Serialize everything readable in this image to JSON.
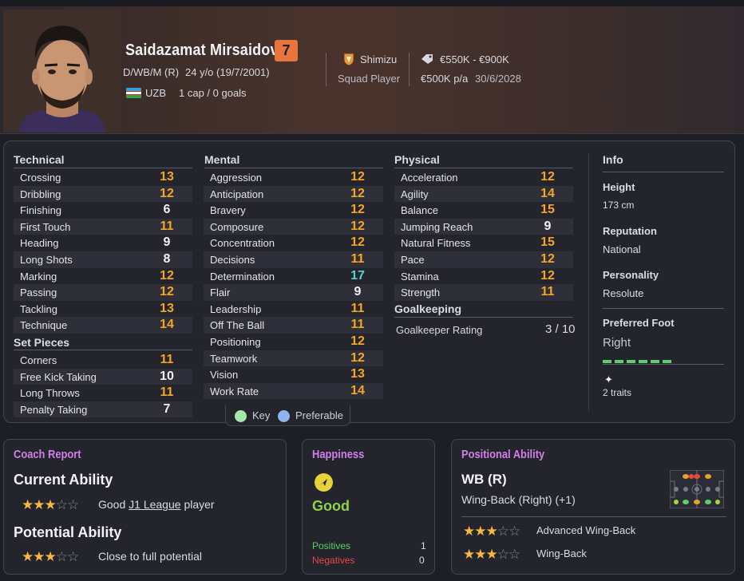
{
  "player": {
    "name": "Saidazamat Mirsaidov",
    "number": "7",
    "positions": "D/WB/M (R)",
    "age": "24 y/o (19/7/2001)",
    "nation": "UZB",
    "caps": "1 cap / 0 goals",
    "club": "Shimizu",
    "squad_status": "Squad Player",
    "value": "€550K - €900K",
    "wage": "€500K p/a",
    "contract_end": "30/6/2028"
  },
  "technical": {
    "title": "Technical",
    "rows": [
      {
        "label": "Crossing",
        "value": "13",
        "color": "orange"
      },
      {
        "label": "Dribbling",
        "value": "12",
        "color": "orange"
      },
      {
        "label": "Finishing",
        "value": "6",
        "color": "white"
      },
      {
        "label": "First Touch",
        "value": "11",
        "color": "orange"
      },
      {
        "label": "Heading",
        "value": "9",
        "color": "white"
      },
      {
        "label": "Long Shots",
        "value": "8",
        "color": "white"
      },
      {
        "label": "Marking",
        "value": "12",
        "color": "orange"
      },
      {
        "label": "Passing",
        "value": "12",
        "color": "orange"
      },
      {
        "label": "Tackling",
        "value": "13",
        "color": "orange"
      },
      {
        "label": "Technique",
        "value": "14",
        "color": "orange"
      }
    ]
  },
  "set_pieces": {
    "title": "Set Pieces",
    "rows": [
      {
        "label": "Corners",
        "value": "11",
        "color": "orange"
      },
      {
        "label": "Free Kick Taking",
        "value": "10",
        "color": "white"
      },
      {
        "label": "Long Throws",
        "value": "11",
        "color": "orange"
      },
      {
        "label": "Penalty Taking",
        "value": "7",
        "color": "white"
      }
    ]
  },
  "mental": {
    "title": "Mental",
    "rows": [
      {
        "label": "Aggression",
        "value": "12",
        "color": "orange"
      },
      {
        "label": "Anticipation",
        "value": "12",
        "color": "orange"
      },
      {
        "label": "Bravery",
        "value": "12",
        "color": "orange"
      },
      {
        "label": "Composure",
        "value": "12",
        "color": "orange"
      },
      {
        "label": "Concentration",
        "value": "12",
        "color": "orange"
      },
      {
        "label": "Decisions",
        "value": "11",
        "color": "orange"
      },
      {
        "label": "Determination",
        "value": "17",
        "color": "teal"
      },
      {
        "label": "Flair",
        "value": "9",
        "color": "white"
      },
      {
        "label": "Leadership",
        "value": "11",
        "color": "orange"
      },
      {
        "label": "Off The Ball",
        "value": "11",
        "color": "orange"
      },
      {
        "label": "Positioning",
        "value": "12",
        "color": "orange"
      },
      {
        "label": "Teamwork",
        "value": "12",
        "color": "orange"
      },
      {
        "label": "Vision",
        "value": "13",
        "color": "orange"
      },
      {
        "label": "Work Rate",
        "value": "14",
        "color": "orange"
      }
    ]
  },
  "physical": {
    "title": "Physical",
    "rows": [
      {
        "label": "Acceleration",
        "value": "12",
        "color": "orange"
      },
      {
        "label": "Agility",
        "value": "14",
        "color": "orange"
      },
      {
        "label": "Balance",
        "value": "15",
        "color": "orange"
      },
      {
        "label": "Jumping Reach",
        "value": "9",
        "color": "white"
      },
      {
        "label": "Natural Fitness",
        "value": "15",
        "color": "orange"
      },
      {
        "label": "Pace",
        "value": "12",
        "color": "orange"
      },
      {
        "label": "Stamina",
        "value": "12",
        "color": "orange"
      },
      {
        "label": "Strength",
        "value": "11",
        "color": "orange"
      }
    ]
  },
  "goalkeeping": {
    "title": "Goalkeeping",
    "label": "Goalkeeper Rating",
    "value": "3 / 10"
  },
  "info": {
    "title": "Info",
    "height_label": "Height",
    "height": "173 cm",
    "reputation_label": "Reputation",
    "reputation": "National",
    "personality_label": "Personality",
    "personality": "Resolute",
    "foot_label": "Preferred Foot",
    "foot": "Right",
    "traits": "2 traits"
  },
  "legend": {
    "key": "Key",
    "preferable": "Preferable"
  },
  "coach_report": {
    "title": "Coach Report",
    "current_label": "Current Ability",
    "current_stars": 3,
    "current_text_pre": "Good",
    "current_link": "J1 League",
    "current_text_post": "player",
    "potential_label": "Potential Ability",
    "potential_stars": 3,
    "potential_text": "Close to full potential"
  },
  "happiness": {
    "title": "Happiness",
    "status": "Good",
    "positives_label": "Positives",
    "positives": "1",
    "negatives_label": "Negatives",
    "negatives": "0"
  },
  "positional": {
    "title": "Positional Ability",
    "position": "WB (R)",
    "position_full": "Wing-Back (Right) (+1)",
    "roles": [
      {
        "name": "Advanced Wing-Back",
        "stars": 3
      },
      {
        "name": "Wing-Back",
        "stars": 3
      }
    ]
  },
  "colors": {
    "accent": "#e8763c",
    "orange": "#f5a623",
    "teal": "#4fd6c8",
    "card_title": "#d37fe8",
    "good": "#8fd14f"
  }
}
